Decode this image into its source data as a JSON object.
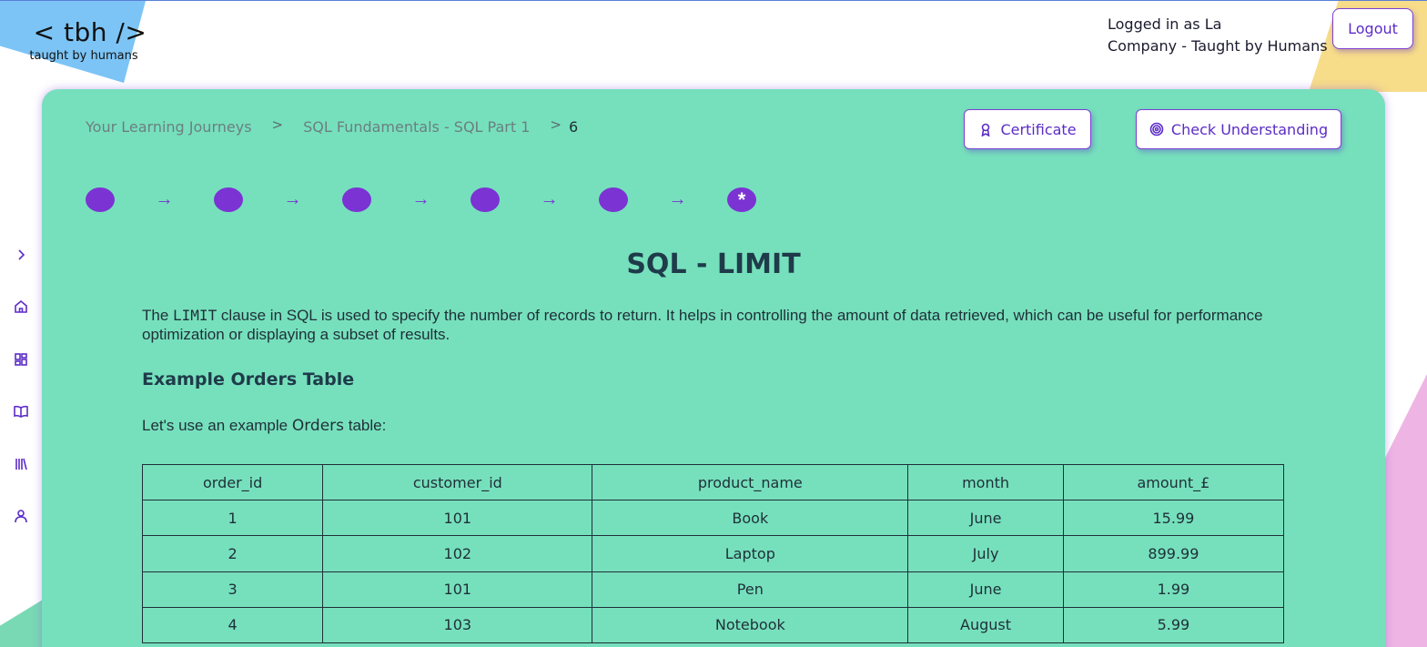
{
  "logo": {
    "main": "< tbh />",
    "sub": "taught by humans"
  },
  "user": {
    "line1": "Logged in as La",
    "line2": "Company - Taught by Humans",
    "logout_label": "Logout"
  },
  "rail": [
    "chevron-right-icon",
    "home-icon",
    "dashboard-icon",
    "book-icon",
    "library-icon",
    "user-icon"
  ],
  "breadcrumb": {
    "item1": "Your Learning Journeys",
    "item2": "SQL Fundamentals - SQL Part 1",
    "current": "6",
    "sep": ">"
  },
  "actions": {
    "certificate": "Certificate",
    "check": "Check Understanding"
  },
  "progress": {
    "total_steps": 6,
    "current_step": 6,
    "current_marker": "*",
    "arrow": "→"
  },
  "lesson": {
    "title": "SQL - LIMIT",
    "intro_pre": "The ",
    "intro_code": "LIMIT",
    "intro_post": " clause in SQL is used to specify the number of records to return. It helps in controlling the amount of data retrieved, which can be useful for performance optimization or displaying a subset of results.",
    "section_title": "Example Orders Table",
    "lead_pre": "Let's use an example ",
    "lead_bold": "Orders",
    "lead_post": " table:"
  },
  "table": {
    "headers": [
      "order_id",
      "customer_id",
      "product_name",
      "month",
      "amount_£"
    ],
    "rows": [
      [
        "1",
        "101",
        "Book",
        "June",
        "15.99"
      ],
      [
        "2",
        "102",
        "Laptop",
        "July",
        "899.99"
      ],
      [
        "3",
        "101",
        "Pen",
        "June",
        "1.99"
      ],
      [
        "4",
        "103",
        "Notebook",
        "August",
        "5.99"
      ]
    ]
  },
  "colors": {
    "card": "#76e0bc",
    "accent": "#7b33d3",
    "text": "#1f3b4a"
  }
}
